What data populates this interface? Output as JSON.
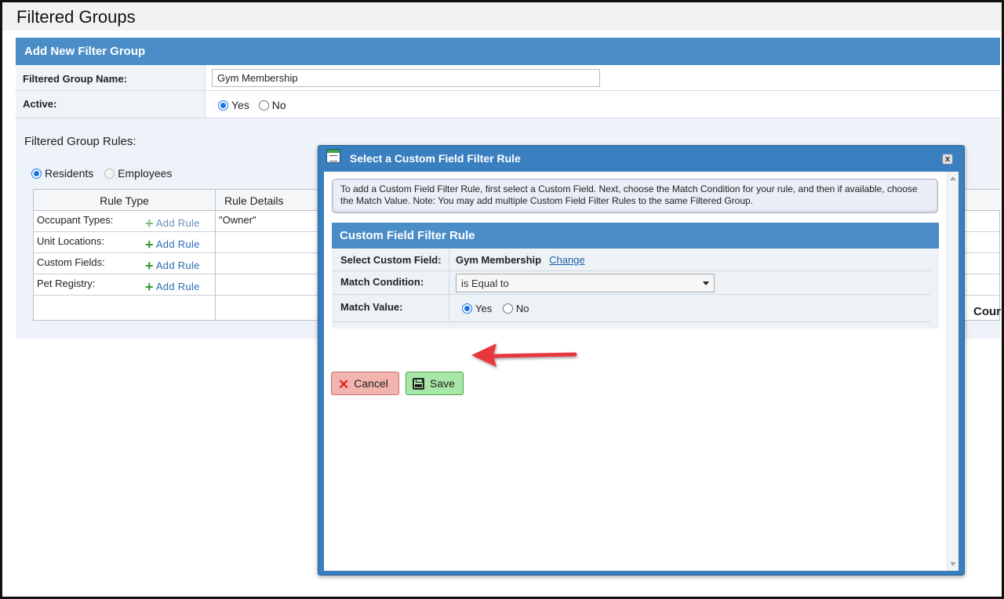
{
  "page": {
    "title": "Filtered Groups"
  },
  "form": {
    "header": "Add New Filter Group",
    "name_label": "Filtered Group Name:",
    "name_value": "Gym Membership",
    "active_label": "Active:",
    "active_yes": "Yes",
    "active_no": "No",
    "rules_title": "Filtered Group Rules:",
    "residents_label": "Residents",
    "employees_label": "Employees"
  },
  "rules_table": {
    "col_rule_type": "Rule Type",
    "col_rule_details": "Rule Details",
    "add_rule_label": "Add Rule",
    "rows": [
      {
        "type": "Occupant Types:",
        "details": "\"Owner\""
      },
      {
        "type": "Unit Locations:",
        "details": ""
      },
      {
        "type": "Custom Fields:",
        "details": ""
      },
      {
        "type": "Pet Registry:",
        "details": ""
      }
    ],
    "count_label": "Cour"
  },
  "dialog": {
    "title": "Select a Custom Field Filter Rule",
    "close_glyph": "x",
    "instructions": "To add a Custom Field Filter Rule, first select a Custom Field. Next, choose the Match Condition for your rule, and then if available, choose the Match Value. Note: You may add multiple Custom Field Filter Rules to the same Filtered Group.",
    "panel_header": "Custom Field Filter Rule",
    "select_field_label": "Select Custom Field:",
    "select_field_value": "Gym Membership",
    "change_link": "Change",
    "match_condition_label": "Match Condition:",
    "match_condition_value": "is Equal to",
    "match_value_label": "Match Value:",
    "match_yes": "Yes",
    "match_no": "No",
    "cancel_label": "Cancel",
    "save_label": "Save"
  },
  "colors": {
    "header_blue": "#4a8dc7",
    "dialog_blue": "#3a7fbf",
    "cancel_bg": "#f2b4ae",
    "save_bg": "#a7e7a7",
    "arrow_red": "#e8383d"
  },
  "icons": [
    "dialog-window-icon",
    "close-icon",
    "plus-icon",
    "x-icon",
    "floppy-disk-icon",
    "red-arrow-annotation"
  ]
}
